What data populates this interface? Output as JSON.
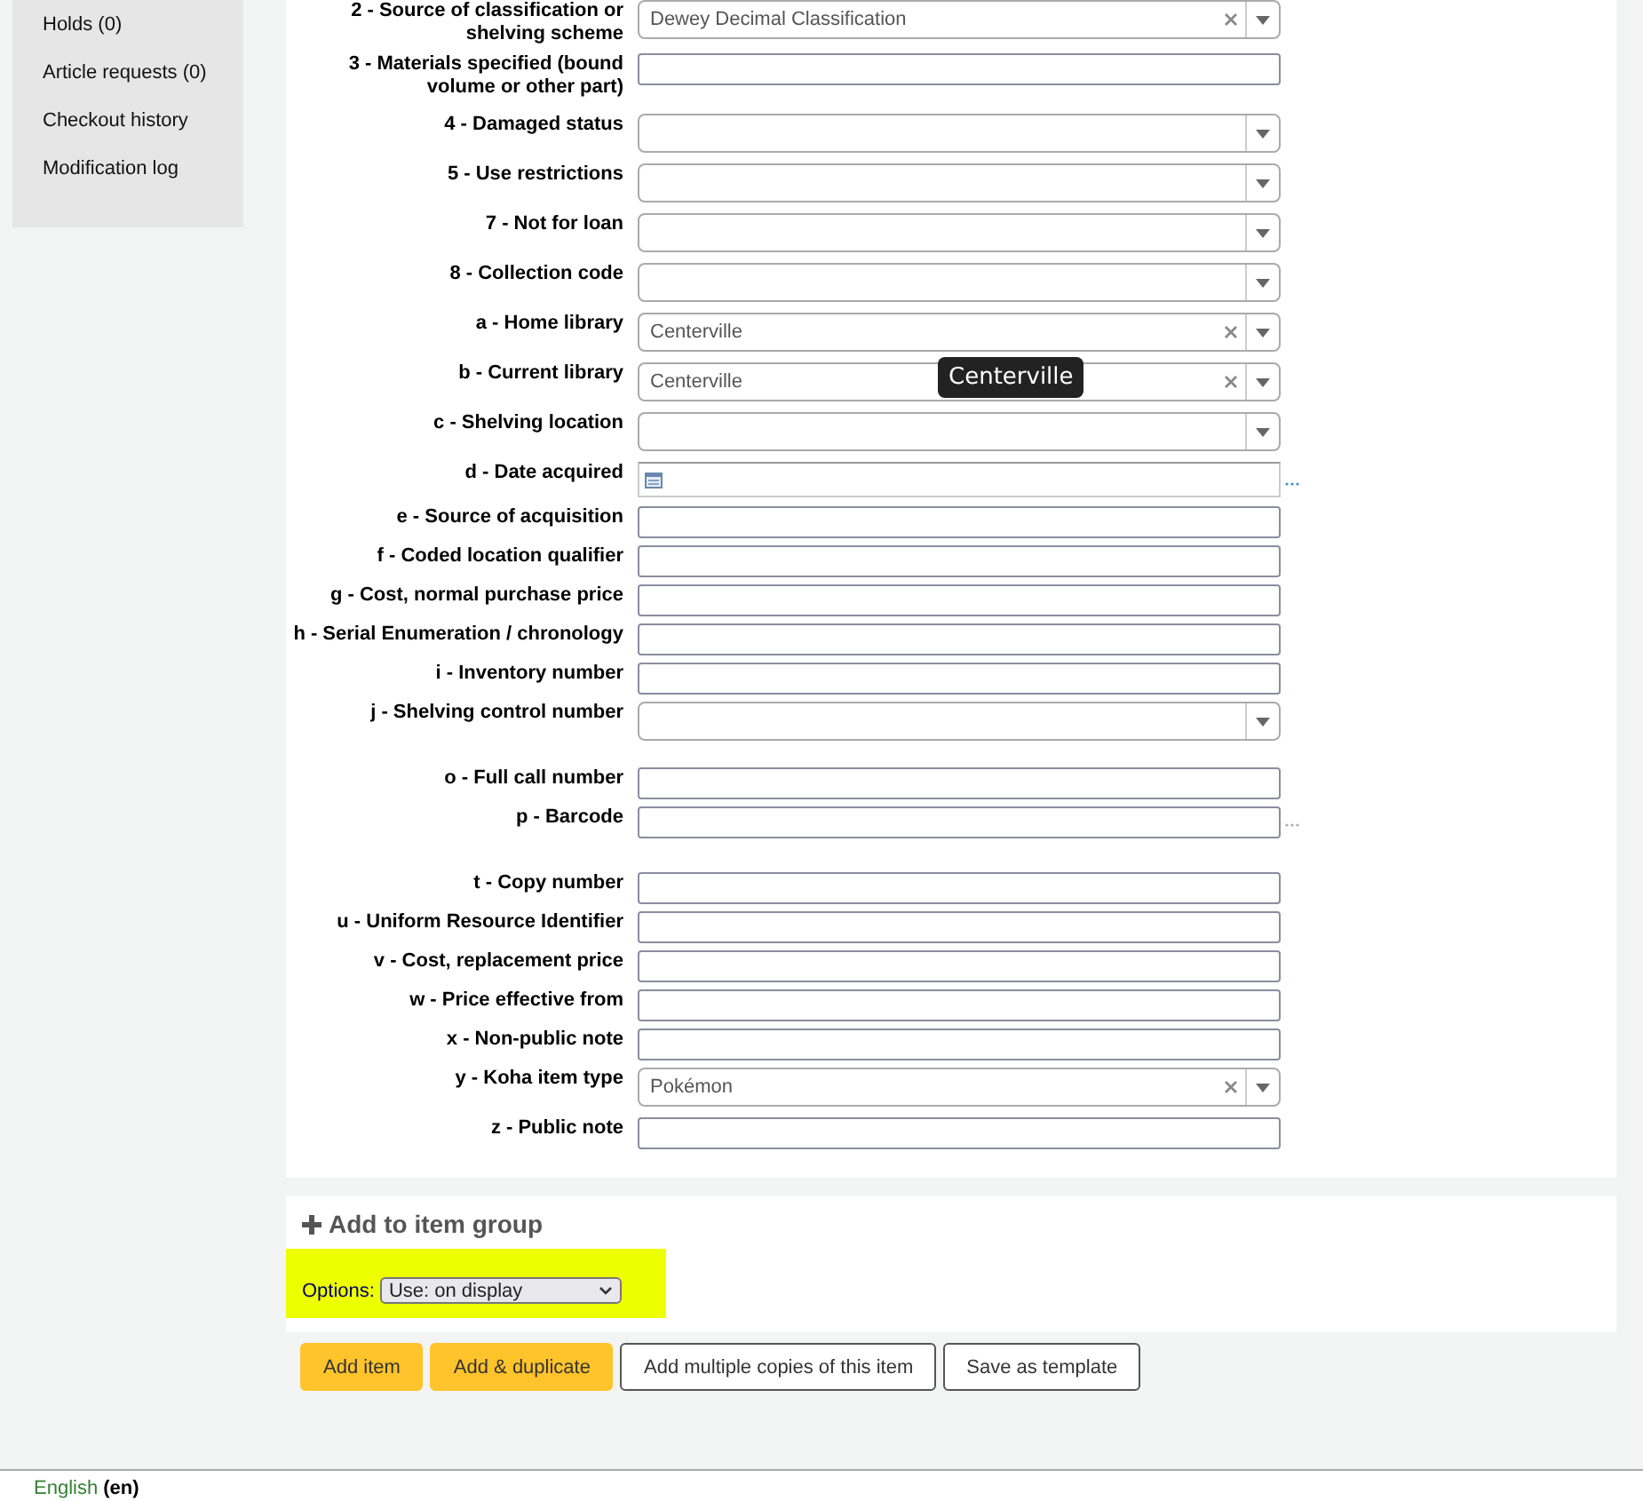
{
  "sidebar": {
    "items": [
      {
        "label": "Holds (0)"
      },
      {
        "label": "Article requests (0)"
      },
      {
        "label": "Checkout history"
      },
      {
        "label": "Modification log"
      }
    ]
  },
  "form": {
    "fields": [
      {
        "label": "2 - Source of classification or shelving scheme",
        "kind": "select",
        "value": "Dewey Decimal Classification"
      },
      {
        "label": "3 - Materials specified (bound volume or other part)",
        "kind": "text"
      },
      {
        "label": "4 - Damaged status",
        "kind": "select"
      },
      {
        "label": "5 - Use restrictions",
        "kind": "select"
      },
      {
        "label": "7 - Not for loan",
        "kind": "select"
      },
      {
        "label": "8 - Collection code",
        "kind": "select"
      },
      {
        "label": "a - Home library",
        "kind": "select",
        "value": "Centerville"
      },
      {
        "label": "b - Current library",
        "kind": "select",
        "value": "Centerville",
        "tooltip": "Centerville"
      },
      {
        "label": "c - Shelving location",
        "kind": "select"
      },
      {
        "label": "d - Date acquired",
        "kind": "date",
        "plugin": true
      },
      {
        "label": "e - Source of acquisition",
        "kind": "text"
      },
      {
        "label": "f - Coded location qualifier",
        "kind": "text"
      },
      {
        "label": "g - Cost, normal purchase price",
        "kind": "text"
      },
      {
        "label": "h - Serial Enumeration / chronology",
        "kind": "text"
      },
      {
        "label": "i - Inventory number",
        "kind": "text"
      },
      {
        "label": "j - Shelving control number",
        "kind": "select",
        "spaced": true
      },
      {
        "label": "o - Full call number",
        "kind": "text"
      },
      {
        "label": "p - Barcode",
        "kind": "text",
        "plugin": true,
        "spaced": true
      },
      {
        "label": "t - Copy number",
        "kind": "text"
      },
      {
        "label": "u - Uniform Resource Identifier",
        "kind": "text"
      },
      {
        "label": "v - Cost, replacement price",
        "kind": "text"
      },
      {
        "label": "w - Price effective from",
        "kind": "text"
      },
      {
        "label": "x - Non-public note",
        "kind": "text"
      },
      {
        "label": "y - Koha item type",
        "kind": "select",
        "value": "Pokémon"
      },
      {
        "label": "z - Public note",
        "kind": "text"
      }
    ]
  },
  "item_group": {
    "title": "Add to item group",
    "options_label": "Options:",
    "options_value": "Use: on display"
  },
  "buttons": [
    {
      "label": "Add item",
      "primary": true
    },
    {
      "label": "Add & duplicate",
      "primary": true
    },
    {
      "label": "Add multiple copies of this item",
      "primary": false
    },
    {
      "label": "Save as template",
      "primary": false
    }
  ],
  "footer": {
    "language": "English",
    "code": "(en)"
  }
}
